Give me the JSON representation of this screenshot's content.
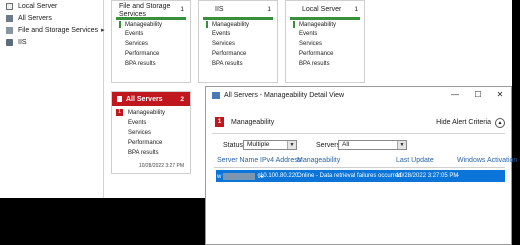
{
  "nav": {
    "items": [
      {
        "label": "Local Server",
        "icon": "server-icon"
      },
      {
        "label": "All Servers",
        "icon": "servers-icon"
      },
      {
        "label": "File and Storage Services",
        "icon": "storage-icon",
        "chevron": "▸"
      },
      {
        "label": "IIS",
        "icon": "iis-icon"
      }
    ]
  },
  "tiles": [
    {
      "title": "File and Storage Services",
      "count": "1",
      "rows": [
        "Manageability",
        "Events",
        "Services",
        "Performance",
        "BPA results"
      ]
    },
    {
      "title": "IIS",
      "count": "1",
      "rows": [
        "Manageability",
        "Events",
        "Services",
        "Performance",
        "BPA results"
      ]
    },
    {
      "title": "Local Server",
      "count": "1",
      "rows": [
        "Manageability",
        "Events",
        "Services",
        "Performance",
        "BPA results"
      ]
    },
    {
      "title": "All Servers",
      "count": "2",
      "badge": "1",
      "rows": [
        "Manageability",
        "Events",
        "Services",
        "Performance",
        "BPA results"
      ],
      "timestamp": "10/28/2022 3:27 PM"
    }
  ],
  "dialog": {
    "title": "All Servers - Manageability Detail View",
    "min_glyph": "—",
    "max_glyph": "☐",
    "close_glyph": "✕",
    "severity_count": "1",
    "severity_label": "Manageability",
    "hide_alert_label": "Hide Alert Criteria",
    "hide_alert_glyph": "▲",
    "status_label": "Status",
    "status_value": "Multiple",
    "servers_label": "Servers",
    "servers_value": "All",
    "dropdown_glyph": "▼",
    "columns": [
      "Server Name",
      "IPv4 Address",
      "Manageability",
      "Last Update",
      "Windows Activation"
    ],
    "row": {
      "server_prefix": "w",
      "server_suffix": "9e",
      "ipv4": "10.100.80.220",
      "manageability": "Online - Data retrieval failures occurred",
      "last_update": "10/28/2022 3:27:05 PM",
      "activation": "-"
    }
  },
  "colors": {
    "accent_red": "#c0161e",
    "accent_green": "#3a8f3a",
    "selection_blue": "#0a74d9",
    "header_blue": "#2a65a8"
  }
}
